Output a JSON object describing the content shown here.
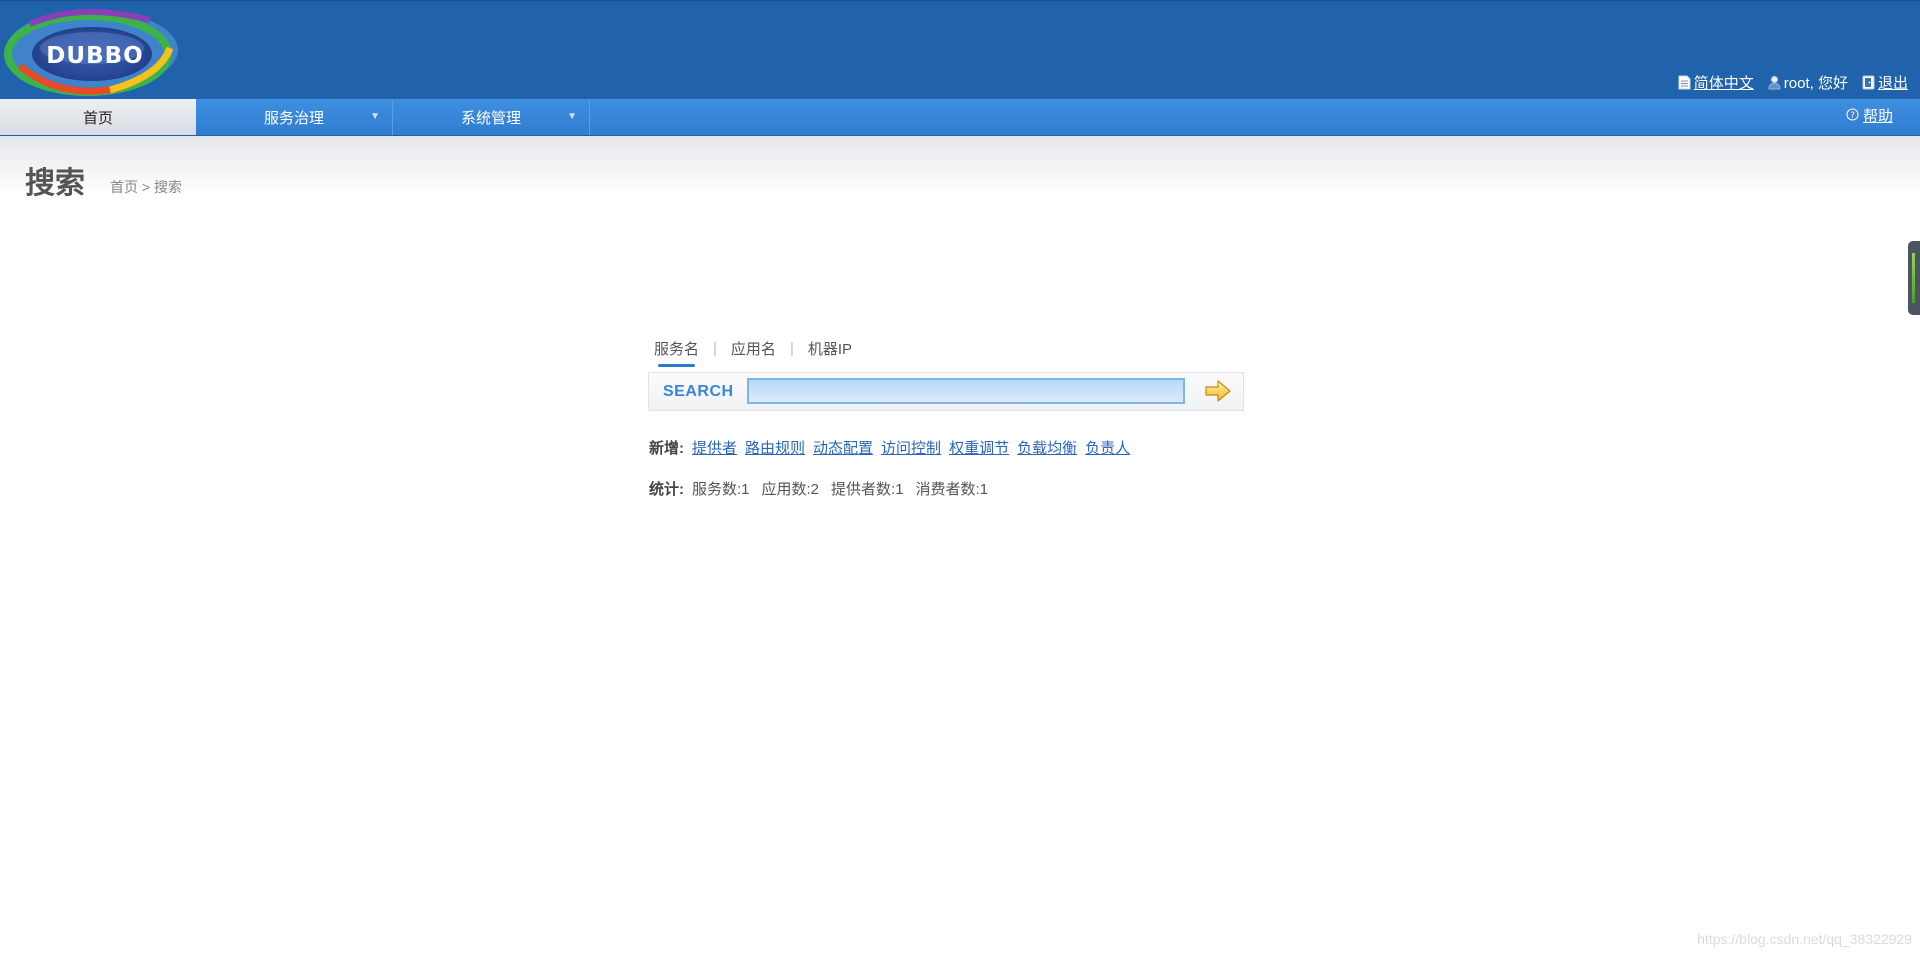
{
  "header": {
    "logo_text": "DUBBO",
    "language_label": "简体中文",
    "greeting": "root, 您好",
    "logout_label": "退出"
  },
  "nav": {
    "items": [
      {
        "label": "首页",
        "active": true
      },
      {
        "label": "服务治理",
        "has_dropdown": true
      },
      {
        "label": "系统管理",
        "has_dropdown": true
      }
    ],
    "help_label": "帮助"
  },
  "page": {
    "title": "搜索",
    "breadcrumb": "首页 > 搜索"
  },
  "search": {
    "tabs": [
      {
        "label": "服务名",
        "active": true
      },
      {
        "label": "应用名",
        "active": false
      },
      {
        "label": "机器IP",
        "active": false
      }
    ],
    "label": "SEARCH",
    "value": ""
  },
  "add": {
    "label": "新增:",
    "links": [
      "提供者",
      "路由规则",
      "动态配置",
      "访问控制",
      "权重调节",
      "负载均衡",
      "负责人"
    ]
  },
  "stats": {
    "label": "统计:",
    "items": [
      "服务数:1",
      "应用数:2",
      "提供者数:1",
      "消费者数:1"
    ]
  },
  "watermark": "https://blog.csdn.net/qq_38322929",
  "colors": {
    "header_bg": "#2062ab",
    "nav_bg": "#3f8fe0",
    "link": "#2a66b8",
    "accent": "#3a85d6"
  }
}
